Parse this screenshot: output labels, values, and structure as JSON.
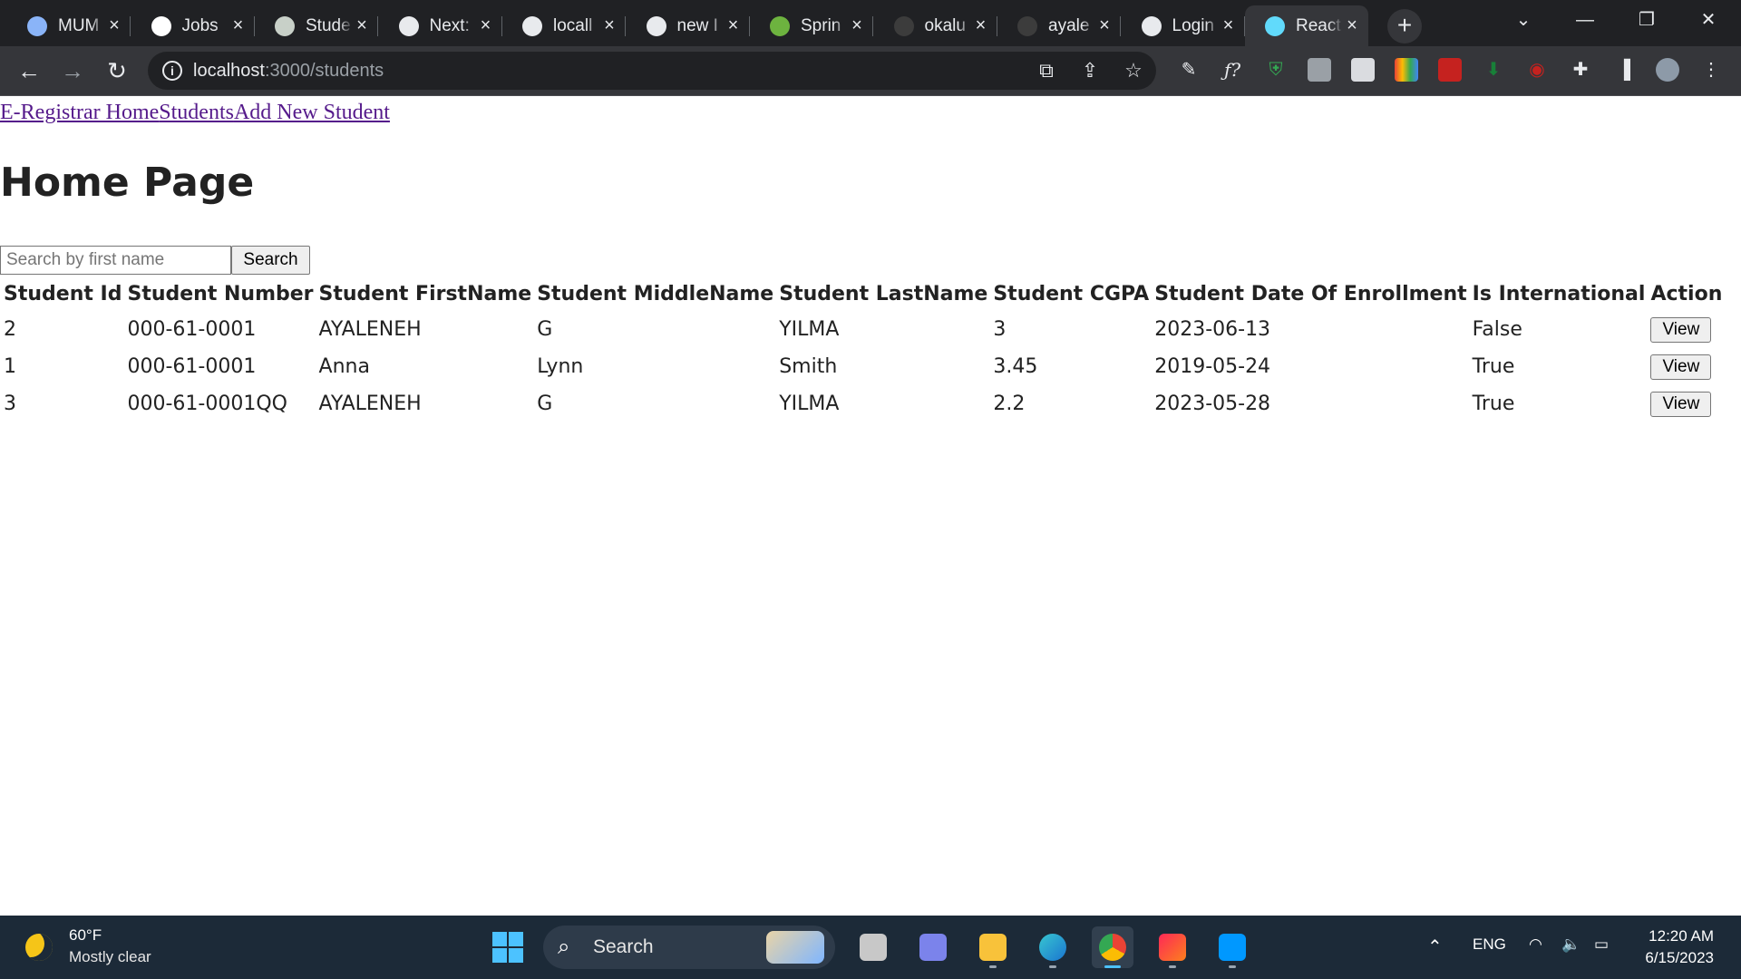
{
  "browser": {
    "tabs": [
      {
        "title": "MUM",
        "icon": "mum-icon",
        "color": "#8ab4f8"
      },
      {
        "title": "Jobs",
        "icon": "jobs-icon",
        "color": "#ffffff"
      },
      {
        "title": "Stude",
        "icon": "chatgpt-icon",
        "color": "#c8d0c8"
      },
      {
        "title": "Next:",
        "icon": "tcs-icon",
        "color": "#e8eaed"
      },
      {
        "title": "locall",
        "icon": "globe-icon",
        "color": "#e8eaed"
      },
      {
        "title": "new I",
        "icon": "globe-icon",
        "color": "#e8eaed"
      },
      {
        "title": "Sprin",
        "icon": "spring-icon",
        "color": "#6db33f"
      },
      {
        "title": "okalu",
        "icon": "github-icon",
        "color": "#3c3c3c"
      },
      {
        "title": "ayale",
        "icon": "github-icon",
        "color": "#3c3c3c"
      },
      {
        "title": "Login",
        "icon": "globe-icon",
        "color": "#e8eaed"
      },
      {
        "title": "React",
        "icon": "react-icon",
        "color": "#61dafb",
        "active": true
      }
    ],
    "url_host": "localhost",
    "url_path": ":3000/students"
  },
  "nav": {
    "brand": "E-Registrar Home",
    "students": "Students",
    "add": "Add New Student"
  },
  "page": {
    "title": "Home Page"
  },
  "search": {
    "placeholder": "Search by first name",
    "value": "",
    "button": "Search"
  },
  "table": {
    "headers": [
      "Student Id",
      "Student Number",
      "Student FirstName",
      "Student MiddleName",
      "Student LastName",
      "Student CGPA",
      "Student Date Of Enrollment",
      "Is International",
      "Action"
    ],
    "rows": [
      {
        "id": "2",
        "number": "000-61-0001",
        "first": "AYALENEH",
        "middle": "G",
        "last": "YILMA",
        "cgpa": "3",
        "date": "2023-06-13",
        "intl": "False",
        "action": "View"
      },
      {
        "id": "1",
        "number": "000-61-0001",
        "first": "Anna",
        "middle": "Lynn",
        "last": "Smith",
        "cgpa": "3.45",
        "date": "2019-05-24",
        "intl": "True",
        "action": "View"
      },
      {
        "id": "3",
        "number": "000-61-0001QQ",
        "first": "AYALENEH",
        "middle": "G",
        "last": "YILMA",
        "cgpa": "2.2",
        "date": "2023-05-28",
        "intl": "True",
        "action": "View"
      }
    ]
  },
  "taskbar": {
    "weather_temp": "60°F",
    "weather_desc": "Mostly clear",
    "search_label": "Search",
    "language": "ENG",
    "time": "12:20 AM",
    "date": "6/15/2023",
    "accent": "#4cc2ff"
  }
}
